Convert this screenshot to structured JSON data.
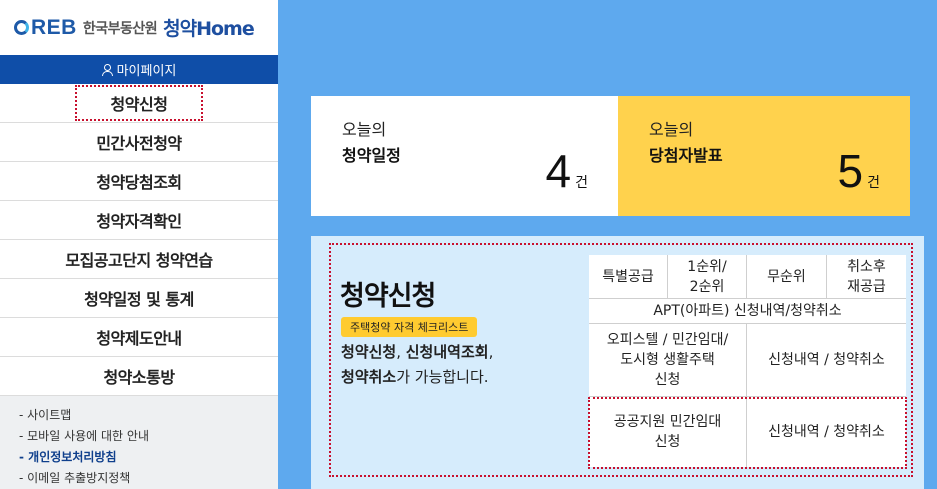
{
  "logo": {
    "ci": "REB",
    "org": "한국부동산원",
    "app": "청약Home"
  },
  "mypage": {
    "label": "마이페이지"
  },
  "menu": [
    "청약신청",
    "민간사전청약",
    "청약당첨조회",
    "청약자격확인",
    "모집공고단지 청약연습",
    "청약일정 및 통계",
    "청약제도안내",
    "청약소통방"
  ],
  "links": [
    "- 사이트맵",
    "- 모바일 사용에 대한 안내",
    "- 개인정보처리방침",
    "- 이메일 추출방지정책"
  ],
  "cards": {
    "schedule": {
      "small": "오늘의",
      "big": "청약일정",
      "count": "4",
      "unit": "건"
    },
    "winners": {
      "small": "오늘의",
      "big": "당첨자발표",
      "count": "5",
      "unit": "건"
    }
  },
  "panel": {
    "title": "청약신청",
    "badge": "주택청약 자격 체크리스트",
    "desc_b1": "청약신청",
    "desc_sep1": ", ",
    "desc_b2": "신청내역조회",
    "desc_sep2": ",",
    "desc_b3": "청약취소",
    "desc_tail": "가 가능합니다."
  },
  "grid": {
    "row1": [
      "특별공급",
      "1순위/\n2순위",
      "무순위",
      "취소후\n재공급"
    ],
    "apt": "APT(아파트) 신청내역/청약취소",
    "officetel": "오피스텔 / 민간임대/\n도시형 생활주택\n신청",
    "officetel_action": "신청내역 / 청약취소",
    "public": "공공지원 민간임대\n신청",
    "public_action": "신청내역 / 청약취소"
  },
  "colors": {
    "background": "#5ea9ee",
    "nav": "#0f4ea8",
    "yellow": "#ffd24d",
    "panel": "#d6ecfc",
    "highlight": "#c8102e"
  }
}
